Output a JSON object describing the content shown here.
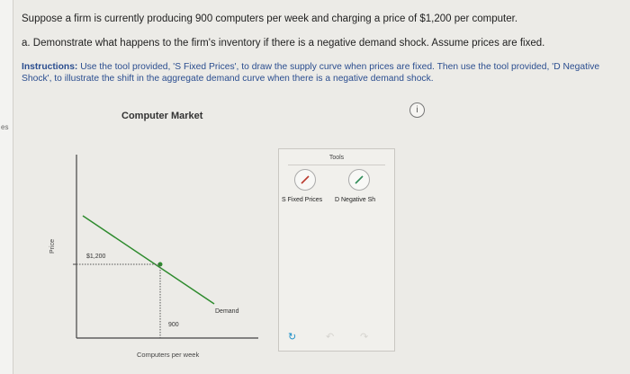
{
  "question": {
    "line1": "Suppose a firm is currently producing 900 computers per week and charging a price of $1,200 per computer.",
    "line2": "a. Demonstrate what happens to the firm's inventory if there is a negative demand shock. Assume prices are fixed."
  },
  "instructions": {
    "prefix": "Instructions:",
    "text": " Use the tool provided, 'S Fixed Prices', to draw the supply curve when prices are fixed. Then use the tool provided, 'D Negative Shock', to illustrate the shift in the aggregate demand curve when there is a negative demand shock."
  },
  "side_label": "es",
  "chart": {
    "title": "Computer Market",
    "ylabel": "Price",
    "xlabel": "Computers per week",
    "price_label": "$1,200",
    "quantity_label": "900",
    "curve_label": "Demand"
  },
  "tools": {
    "title": "Tools",
    "items": [
      {
        "label": "S Fixed Prices"
      },
      {
        "label": "D Negative Sh"
      }
    ]
  },
  "colors": {
    "demand_line": "#2e8b2e",
    "instructions": "#2a4d8f",
    "tool_pencil": "#b93a2e",
    "tool_pencil_2": "#2e8b57"
  }
}
